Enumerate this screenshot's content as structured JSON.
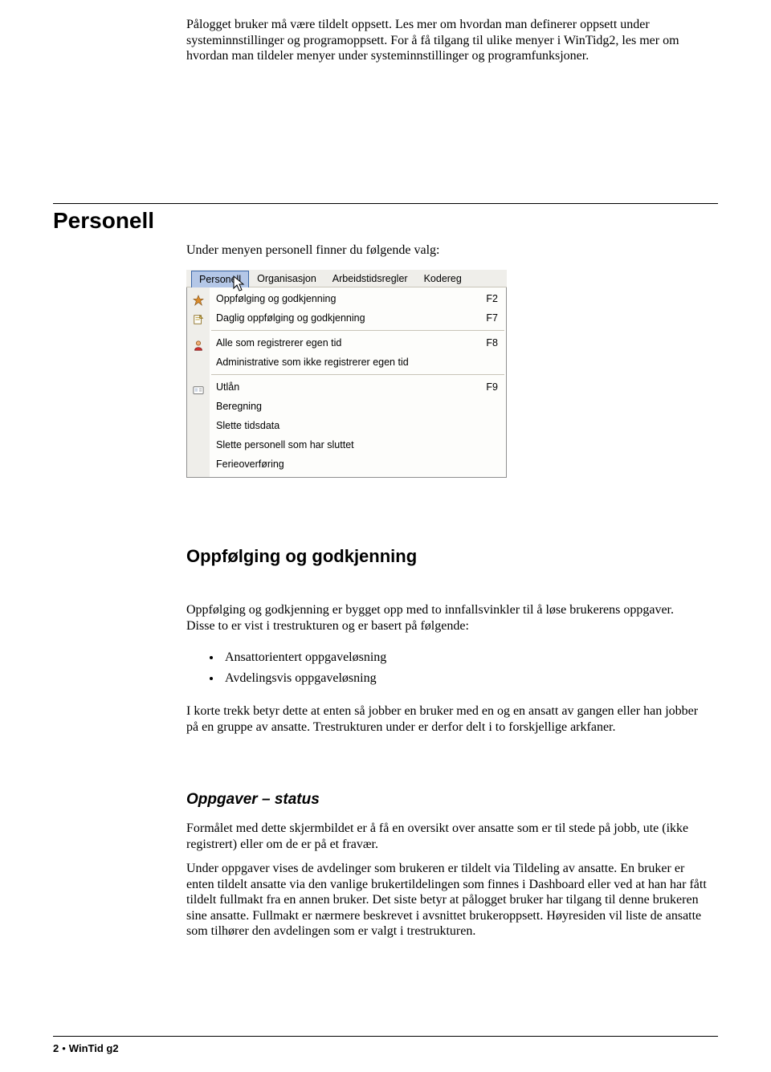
{
  "intro": "Pålogget bruker må være tildelt oppsett. Les mer om hvordan man definerer oppsett under systeminnstillinger og programoppsett. For å få tilgang til ulike menyer i WinTidg2, les mer om hvordan man tildeler menyer under systeminnstillinger og programfunksjoner.",
  "section_title": "Personell",
  "personell_intro": "Under menyen personell finner du følgende valg:",
  "menu": {
    "top": [
      "Personell",
      "Organisasjon",
      "Arbeidstidsregler",
      "Kodereg"
    ],
    "items": [
      {
        "label": "Oppfølging og godkjenning",
        "shortcut": "F2",
        "icon": "star"
      },
      {
        "label": "Daglig oppfølging og godkjenning",
        "shortcut": "F7",
        "icon": "note"
      },
      {
        "sep": true
      },
      {
        "label": "Alle som registrerer egen tid",
        "shortcut": "F8",
        "icon": "person"
      },
      {
        "label": "Administrative som ikke registrerer egen tid",
        "shortcut": "",
        "icon": ""
      },
      {
        "sep": true
      },
      {
        "label": "Utlån",
        "shortcut": "F9",
        "icon": "card"
      },
      {
        "label": "Beregning",
        "shortcut": "",
        "icon": ""
      },
      {
        "label": "Slette tidsdata",
        "shortcut": "",
        "icon": ""
      },
      {
        "label": "Slette personell som har sluttet",
        "shortcut": "",
        "icon": ""
      },
      {
        "label": "Ferieoverføring",
        "shortcut": "",
        "icon": ""
      }
    ]
  },
  "h2": "Oppfølging og godkjenning",
  "para_a": "Oppfølging og godkjenning er bygget opp med to innfallsvinkler til å løse brukerens oppgaver. Disse to er vist i trestrukturen og er basert på følgende:",
  "bullets": [
    "Ansattorientert oppgaveløsning",
    "Avdelingsvis oppgaveløsning"
  ],
  "para_b": "I korte trekk betyr dette at enten så jobber en bruker med en og en ansatt av gangen eller han jobber på en gruppe av ansatte. Trestrukturen under er derfor delt i to forskjellige arkfaner.",
  "h3": "Oppgaver – status",
  "para_c": "Formålet med dette skjermbildet er å få en oversikt over ansatte som er til stede på jobb, ute (ikke registrert) eller om de er på et fravær.",
  "para_d": "Under oppgaver vises de avdelinger som brukeren er tildelt via Tildeling av ansatte. En bruker er enten tildelt ansatte via den vanlige brukertildelingen som finnes i Dashboard eller ved at han har fått tildelt fullmakt fra en annen bruker. Det siste betyr at pålogget bruker har tilgang til denne brukeren sine ansatte. Fullmakt er nærmere beskrevet i avsnittet brukeroppsett. Høyresiden vil liste de ansatte som tilhører den avdelingen som er valgt i trestrukturen.",
  "footer": {
    "page": "2",
    "product": "WinTid g2"
  }
}
